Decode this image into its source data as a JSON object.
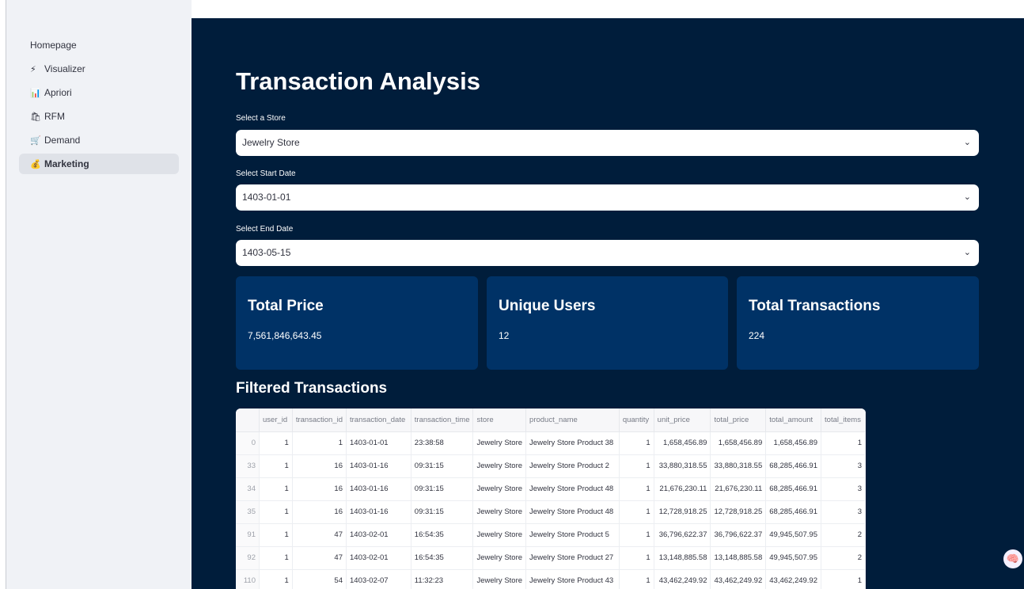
{
  "sidebar": {
    "items": [
      {
        "icon": "",
        "label": "Homepage"
      },
      {
        "icon": "⚡",
        "label": "Visualizer"
      },
      {
        "icon": "📊",
        "label": "Apriori"
      },
      {
        "icon": "🛍",
        "label": "RFM"
      },
      {
        "icon": "🛒",
        "label": "Demand"
      },
      {
        "icon": "💰",
        "label": "Marketing"
      }
    ],
    "active_index": 5
  },
  "main": {
    "title": "Transaction Analysis",
    "store_label": "Select a Store",
    "store_value": "Jewelry Store",
    "start_label": "Select Start Date",
    "start_value": "1403-01-01",
    "end_label": "Select End Date",
    "end_value": "1403-05-15",
    "chevron": "⌄"
  },
  "metrics": [
    {
      "title": "Total Price",
      "value": "7,561,846,643.45"
    },
    {
      "title": "Unique Users",
      "value": "12"
    },
    {
      "title": "Total Transactions",
      "value": "224"
    }
  ],
  "table": {
    "title": "Filtered Transactions",
    "columns": [
      "",
      "user_id",
      "transaction_id",
      "transaction_date",
      "transaction_time",
      "store",
      "product_name",
      "quantity",
      "unit_price",
      "total_price",
      "total_amount",
      "total_items"
    ],
    "rows": [
      [
        "0",
        "1",
        "1",
        "1403-01-01",
        "23:38:58",
        "Jewelry Store",
        "Jewelry Store Product 38",
        "1",
        "1,658,456.89",
        "1,658,456.89",
        "1,658,456.89",
        "1"
      ],
      [
        "33",
        "1",
        "16",
        "1403-01-16",
        "09:31:15",
        "Jewelry Store",
        "Jewelry Store Product 2",
        "1",
        "33,880,318.55",
        "33,880,318.55",
        "68,285,466.91",
        "3"
      ],
      [
        "34",
        "1",
        "16",
        "1403-01-16",
        "09:31:15",
        "Jewelry Store",
        "Jewelry Store Product 48",
        "1",
        "21,676,230.11",
        "21,676,230.11",
        "68,285,466.91",
        "3"
      ],
      [
        "35",
        "1",
        "16",
        "1403-01-16",
        "09:31:15",
        "Jewelry Store",
        "Jewelry Store Product 48",
        "1",
        "12,728,918.25",
        "12,728,918.25",
        "68,285,466.91",
        "3"
      ],
      [
        "91",
        "1",
        "47",
        "1403-02-01",
        "16:54:35",
        "Jewelry Store",
        "Jewelry Store Product 5",
        "1",
        "36,796,622.37",
        "36,796,622.37",
        "49,945,507.95",
        "2"
      ],
      [
        "92",
        "1",
        "47",
        "1403-02-01",
        "16:54:35",
        "Jewelry Store",
        "Jewelry Store Product 27",
        "1",
        "13,148,885.58",
        "13,148,885.58",
        "49,945,507.95",
        "2"
      ],
      [
        "110",
        "1",
        "54",
        "1403-02-07",
        "11:32:23",
        "Jewelry Store",
        "Jewelry Store Product 43",
        "1",
        "43,462,249.92",
        "43,462,249.92",
        "43,462,249.92",
        "1"
      ]
    ]
  },
  "assistant_icon": "🧠"
}
